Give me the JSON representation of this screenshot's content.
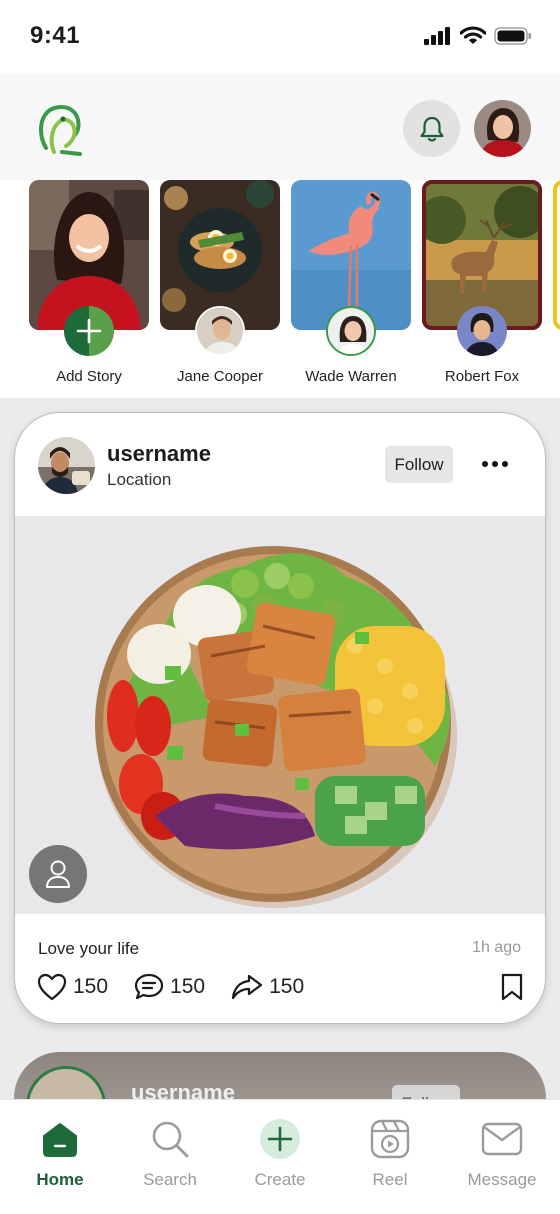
{
  "status_bar": {
    "time": "9:41"
  },
  "header": {
    "logo_icon": "parrot-logo-icon",
    "notification_icon": "bell-icon"
  },
  "stories": [
    {
      "label": "Add Story",
      "type": "add"
    },
    {
      "label": "Jane Cooper",
      "type": "user"
    },
    {
      "label": "Wade Warren",
      "type": "user"
    },
    {
      "label": "Robert Fox",
      "type": "user",
      "highlight_color": "#6b1b1f"
    }
  ],
  "post": {
    "username": "username",
    "location": "Location",
    "follow_label": "Follow",
    "caption": "Love your life",
    "time": "1h ago",
    "likes": "150",
    "comments": "150",
    "shares": "150"
  },
  "post2": {
    "username": "username",
    "follow_label": "Follow"
  },
  "tabs": [
    {
      "label": "Home",
      "icon": "home-icon",
      "active": true
    },
    {
      "label": "Search",
      "icon": "search-icon"
    },
    {
      "label": "Create",
      "icon": "plus-icon"
    },
    {
      "label": "Reel",
      "icon": "reel-icon"
    },
    {
      "label": "Message",
      "icon": "envelope-icon"
    }
  ],
  "colors": {
    "brand": "#1e5f37",
    "accent_light": "#d5ebdc",
    "story_highlight": "#6b1b1f"
  }
}
